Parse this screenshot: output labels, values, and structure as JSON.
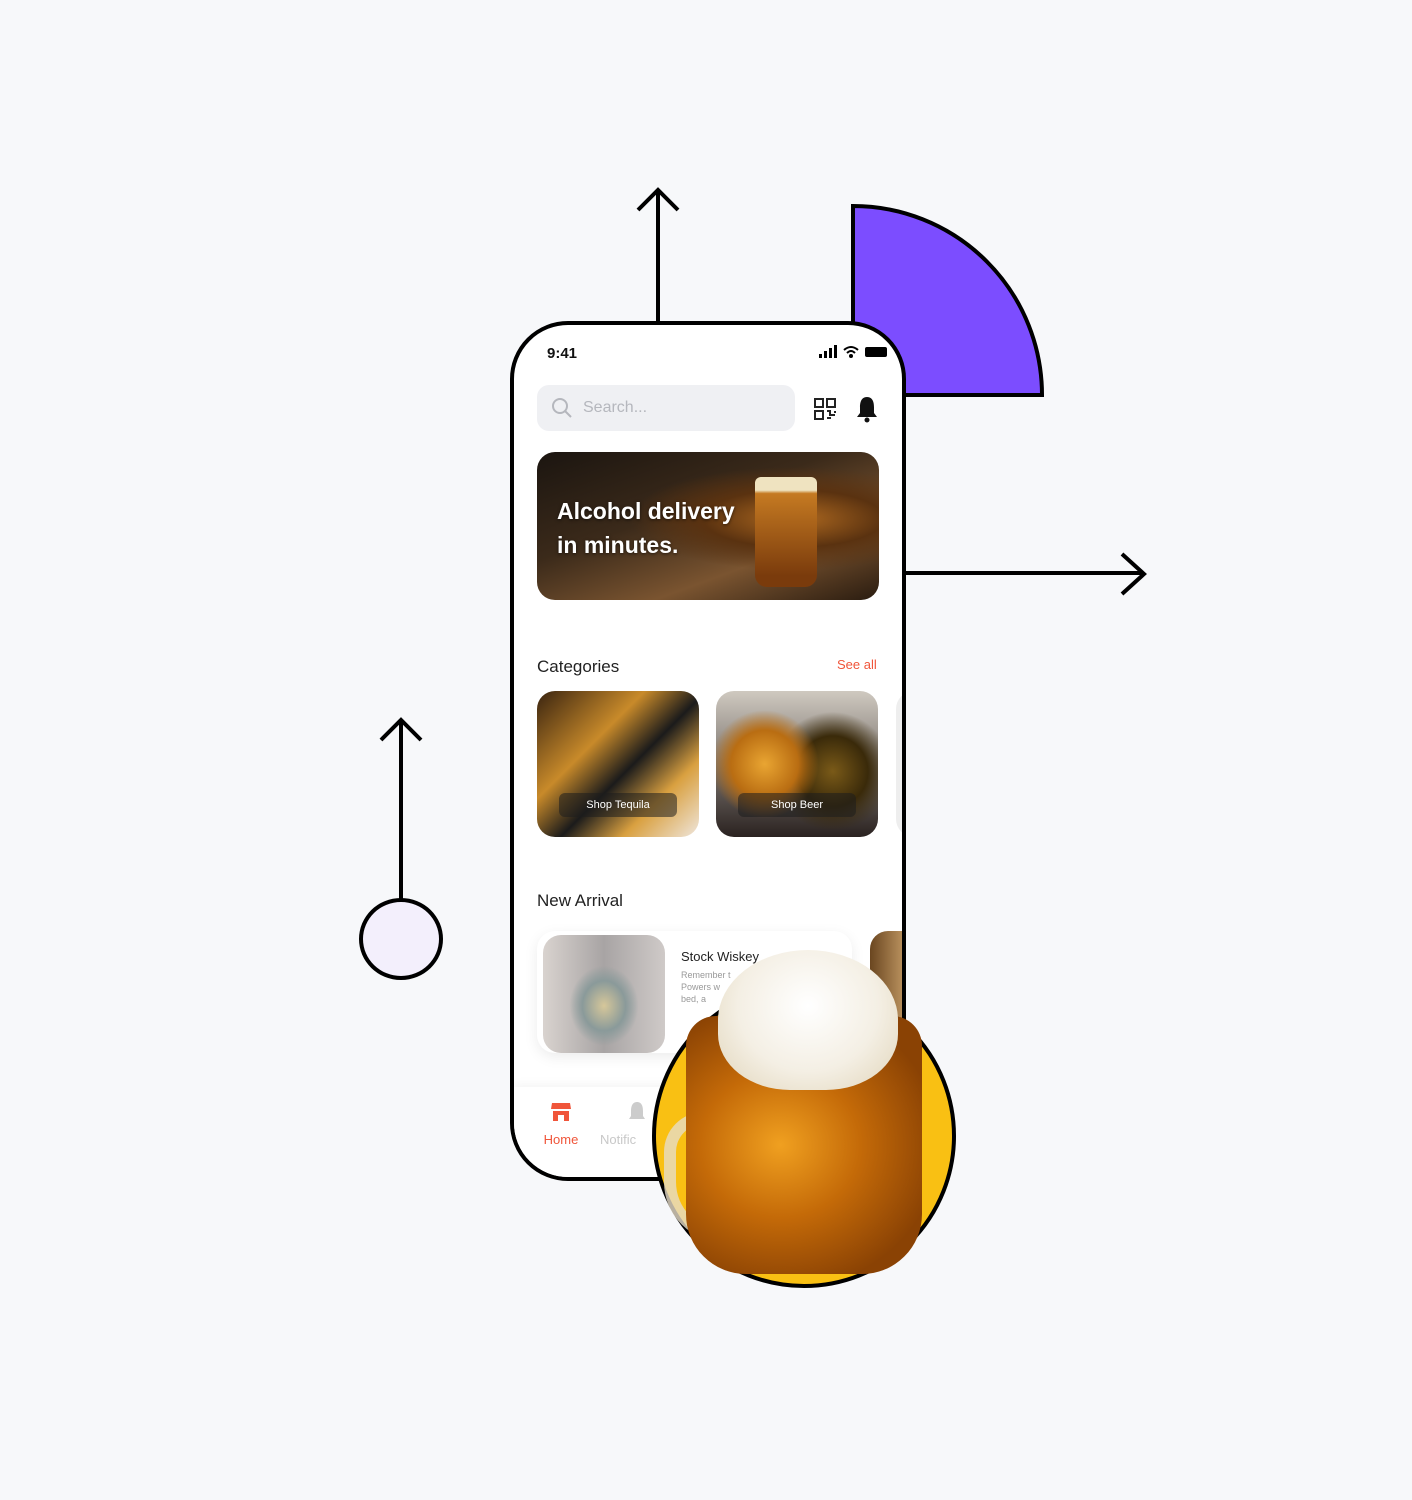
{
  "status": {
    "time": "9:41"
  },
  "search": {
    "placeholder": "Search..."
  },
  "banner": {
    "line1": "Alcohol delivery",
    "line2": "in minutes."
  },
  "categories": {
    "title": "Categories",
    "see_all": "See all",
    "items": [
      {
        "label": "Shop Tequila"
      },
      {
        "label": "Shop Beer"
      }
    ]
  },
  "new_arrival": {
    "title": "New Arrival",
    "items": [
      {
        "name": "Stock Wiskey",
        "desc_lines": [
          "Remember t",
          "Powers w",
          "bed, a"
        ]
      }
    ]
  },
  "nav": {
    "items": [
      {
        "label": "Home",
        "active": true
      },
      {
        "label": "Notific",
        "active": false
      }
    ]
  },
  "colors": {
    "accent": "#f0553a",
    "purple": "#7c4dff",
    "yellow": "#f9c013",
    "circle": "#f3effc"
  }
}
